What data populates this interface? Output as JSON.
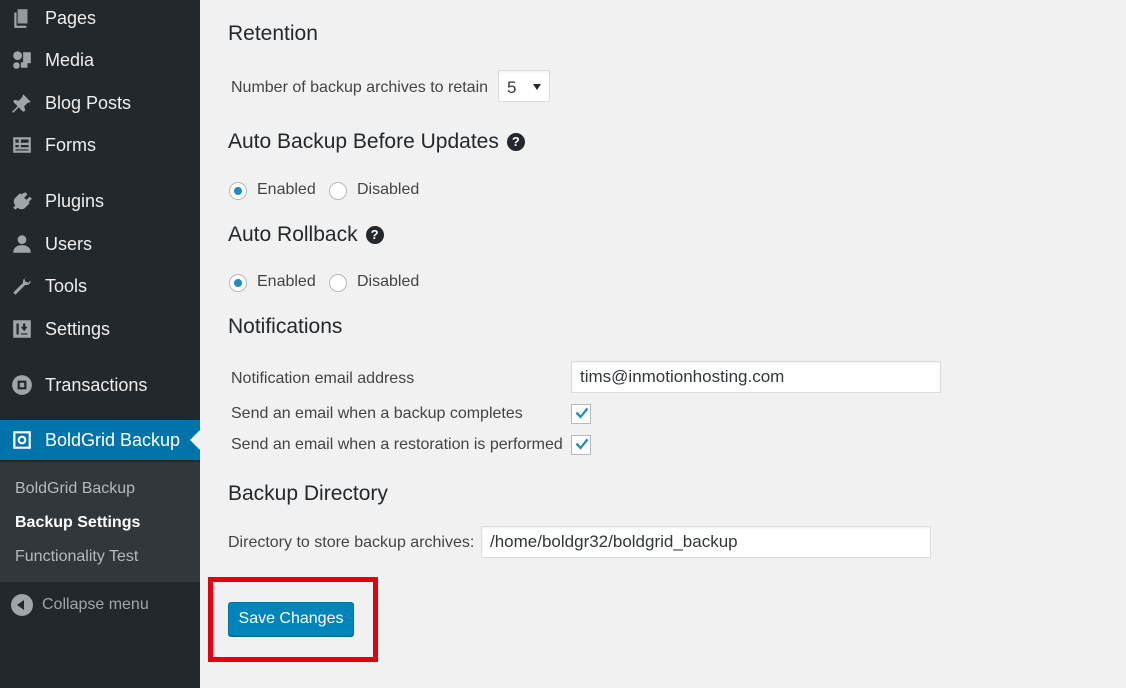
{
  "sidebar": {
    "items": [
      {
        "label": "Pages",
        "icon": "pages-icon"
      },
      {
        "label": "Media",
        "icon": "media-icon"
      },
      {
        "label": "Blog Posts",
        "icon": "pin-icon"
      },
      {
        "label": "Forms",
        "icon": "forms-icon"
      },
      {
        "label": "Plugins",
        "icon": "plugins-icon"
      },
      {
        "label": "Users",
        "icon": "users-icon"
      },
      {
        "label": "Tools",
        "icon": "wrench-icon"
      },
      {
        "label": "Settings",
        "icon": "settings-icon"
      },
      {
        "label": "Transactions",
        "icon": "transactions-icon"
      },
      {
        "label": "BoldGrid Backup",
        "icon": "backup-icon",
        "active": true
      }
    ],
    "submenu": [
      {
        "label": "BoldGrid Backup"
      },
      {
        "label": "Backup Settings",
        "current": true
      },
      {
        "label": "Functionality Test"
      }
    ],
    "collapse_label": "Collapse menu"
  },
  "retention": {
    "heading": "Retention",
    "label": "Number of backup archives to retain",
    "value": "5"
  },
  "auto_backup": {
    "heading": "Auto Backup Before Updates",
    "help": "?",
    "enabled_label": "Enabled",
    "disabled_label": "Disabled",
    "selected": "Enabled"
  },
  "auto_rollback": {
    "heading": "Auto Rollback",
    "help": "?",
    "enabled_label": "Enabled",
    "disabled_label": "Disabled",
    "selected": "Enabled"
  },
  "notifications": {
    "heading": "Notifications",
    "email_label": "Notification email address",
    "email_value": "tims@inmotionhosting.com",
    "backup_complete_label": "Send an email when a backup completes",
    "backup_complete_checked": true,
    "restore_label": "Send an email when a restoration is performed",
    "restore_checked": true
  },
  "backup_directory": {
    "heading": "Backup Directory",
    "label": "Directory to store backup archives:",
    "value": "/home/boldgr32/boldgrid_backup"
  },
  "save_label": "Save Changes",
  "colors": {
    "sidebar_bg": "#23282d",
    "active_bg": "#0073aa",
    "button_bg": "#0085ba",
    "highlight": "#e3000f"
  }
}
